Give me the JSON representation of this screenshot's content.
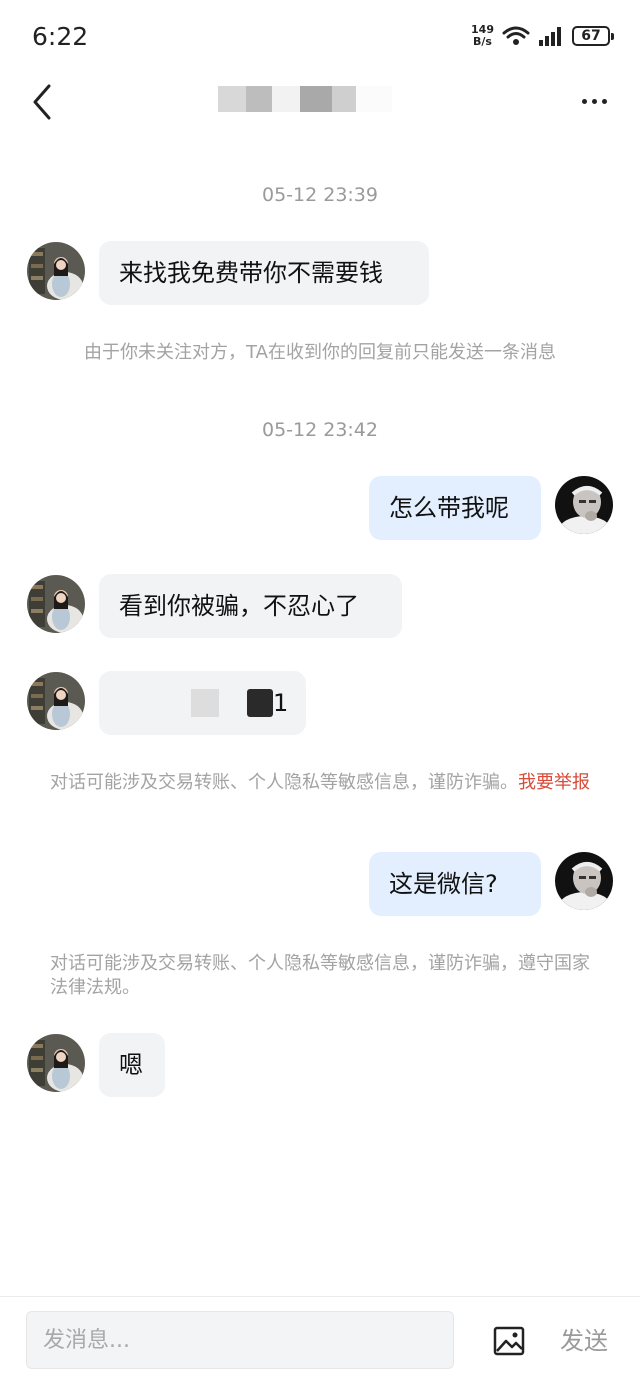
{
  "status_bar": {
    "time": "6:22",
    "net_speed_value": "149",
    "net_speed_unit": "B/s",
    "battery": "67"
  },
  "header": {
    "back_icon": "chevron-left-icon",
    "more_icon": "more-horizontal-icon"
  },
  "messages": {
    "ts1": "05-12 23:39",
    "m1": "来找我免费带你不需要钱",
    "notice1": "由于你未关注对方，TA在收到你的回复前只能发送一条消息",
    "ts2": "05-12 23:42",
    "m2": "怎么带我呢",
    "m3": "看到你被骗，不忍心了",
    "m4_tail": "1",
    "notice2_text": "对话可能涉及交易转账、个人隐私等敏感信息，谨防诈骗。",
    "notice2_link": "我要举报",
    "m5": "这是微信?",
    "notice3": "对话可能涉及交易转账、个人隐私等敏感信息，谨防诈骗，遵守国家法律法规。",
    "m6": "嗯"
  },
  "composer": {
    "placeholder": "发消息...",
    "image_icon": "image-icon",
    "send_label": "发送"
  },
  "colors": {
    "left_bubble": "#f2f3f5",
    "right_bubble": "#e3efff",
    "report_link": "#d84a3a",
    "muted_text": "#a3a3a3"
  }
}
